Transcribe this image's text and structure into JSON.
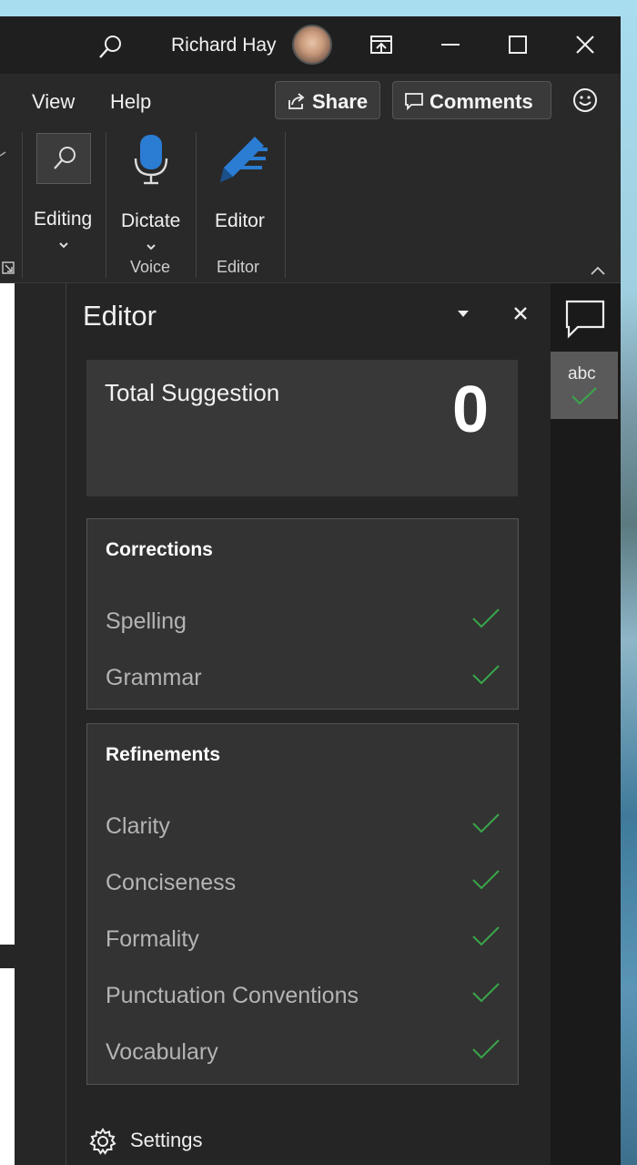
{
  "titlebar": {
    "user_name": "Richard Hay",
    "icons": [
      "search-icon",
      "ribbon-display-icon",
      "minimize-icon",
      "maximize-icon",
      "close-icon"
    ]
  },
  "tabs": {
    "view": "View",
    "help": "Help",
    "share": "Share",
    "comments": "Comments"
  },
  "ribbon": {
    "editing_label": "Editing",
    "dictate_label": "Dictate",
    "editor_label": "Editor",
    "voice_group": "Voice",
    "editor_group": "Editor"
  },
  "pane": {
    "title": "Editor",
    "total_label": "Total Suggestion",
    "total_value": "0",
    "corrections": {
      "title": "Corrections",
      "items": [
        "Spelling",
        "Grammar"
      ]
    },
    "refinements": {
      "title": "Refinements",
      "items": [
        "Clarity",
        "Conciseness",
        "Formality",
        "Punctuation Conventions",
        "Vocabulary"
      ]
    },
    "settings_label": "Settings"
  },
  "rail": {
    "editor_tile_text": "abc"
  },
  "colors": {
    "accent_blue": "#2b7cd3",
    "check_green": "#3aa64a",
    "pane_bg": "#252525"
  }
}
